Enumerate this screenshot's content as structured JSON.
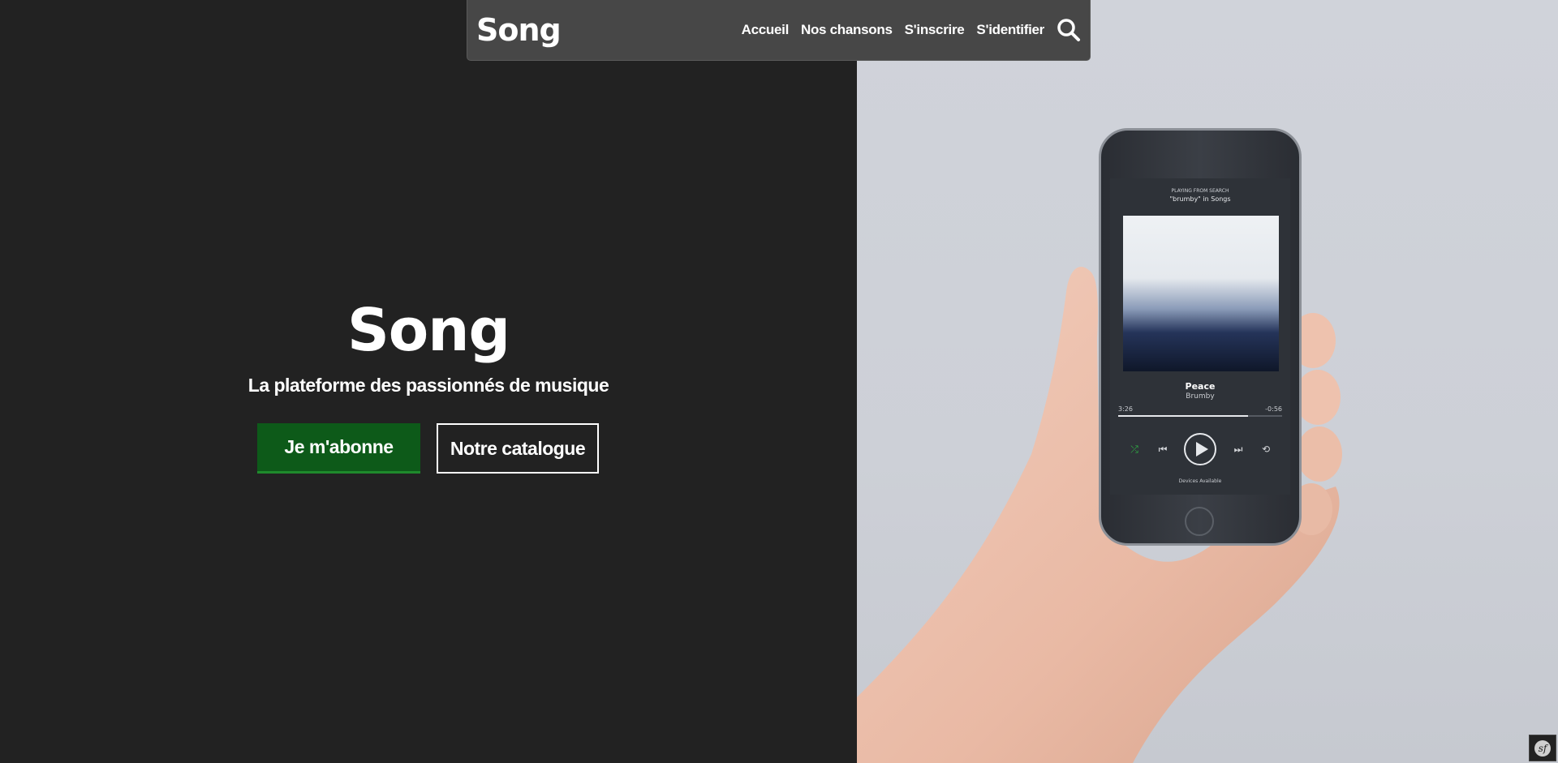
{
  "navbar": {
    "brand": "Song",
    "links": [
      {
        "label": "Accueil"
      },
      {
        "label": "Nos chansons"
      },
      {
        "label": "S'inscrire"
      },
      {
        "label": "S'identifier"
      }
    ],
    "search_icon": "search-icon"
  },
  "hero": {
    "title": "Song",
    "subtitle": "La plateforme des passionnés de musique",
    "primary_button": "Je m'abonne",
    "secondary_button": "Notre catalogue"
  },
  "phone_player": {
    "header_line1": "PLAYING FROM SEARCH",
    "header_line2": "\"brumby\" in Songs",
    "track_title": "Peace",
    "track_artist": "Brumby",
    "elapsed": "3:26",
    "remaining": "-0:56",
    "progress": 0.79,
    "devices_label": "Devices Available"
  },
  "colors": {
    "background": "#222222",
    "navbar": "#474747",
    "primary_button": "#0d5a19",
    "accent_green": "#1f8a2c",
    "text": "#ffffff"
  },
  "badge": {
    "icon": "symfony-icon"
  }
}
